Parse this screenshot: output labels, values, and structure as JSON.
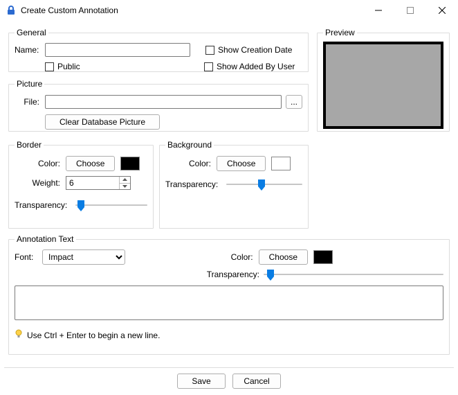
{
  "window": {
    "title": "Create Custom Annotation"
  },
  "general": {
    "legend": "General",
    "name_label": "Name:",
    "name_value": "",
    "public_label": "Public",
    "show_creation_date_label": "Show Creation Date",
    "show_added_by_user_label": "Show Added By User"
  },
  "preview": {
    "legend": "Preview"
  },
  "picture": {
    "legend": "Picture",
    "file_label": "File:",
    "file_value": "",
    "browse_label": "...",
    "clear_label": "Clear Database Picture"
  },
  "border": {
    "legend": "Border",
    "color_label": "Color:",
    "choose_label": "Choose",
    "color_value": "#000000",
    "weight_label": "Weight:",
    "weight_value": "6",
    "transparency_label": "Transparency:",
    "transparency_value": 3
  },
  "background": {
    "legend": "Background",
    "color_label": "Color:",
    "choose_label": "Choose",
    "color_value": "#ffffff",
    "transparency_label": "Transparency:",
    "transparency_value": 46
  },
  "text": {
    "legend": "Annotation Text",
    "font_label": "Font:",
    "font_value": "Impact",
    "color_label": "Color:",
    "choose_label": "Choose",
    "color_value": "#000000",
    "transparency_label": "Transparency:",
    "transparency_value": 2,
    "body": "",
    "hint": "Use Ctrl + Enter to begin a new line."
  },
  "footer": {
    "save_label": "Save",
    "cancel_label": "Cancel"
  }
}
